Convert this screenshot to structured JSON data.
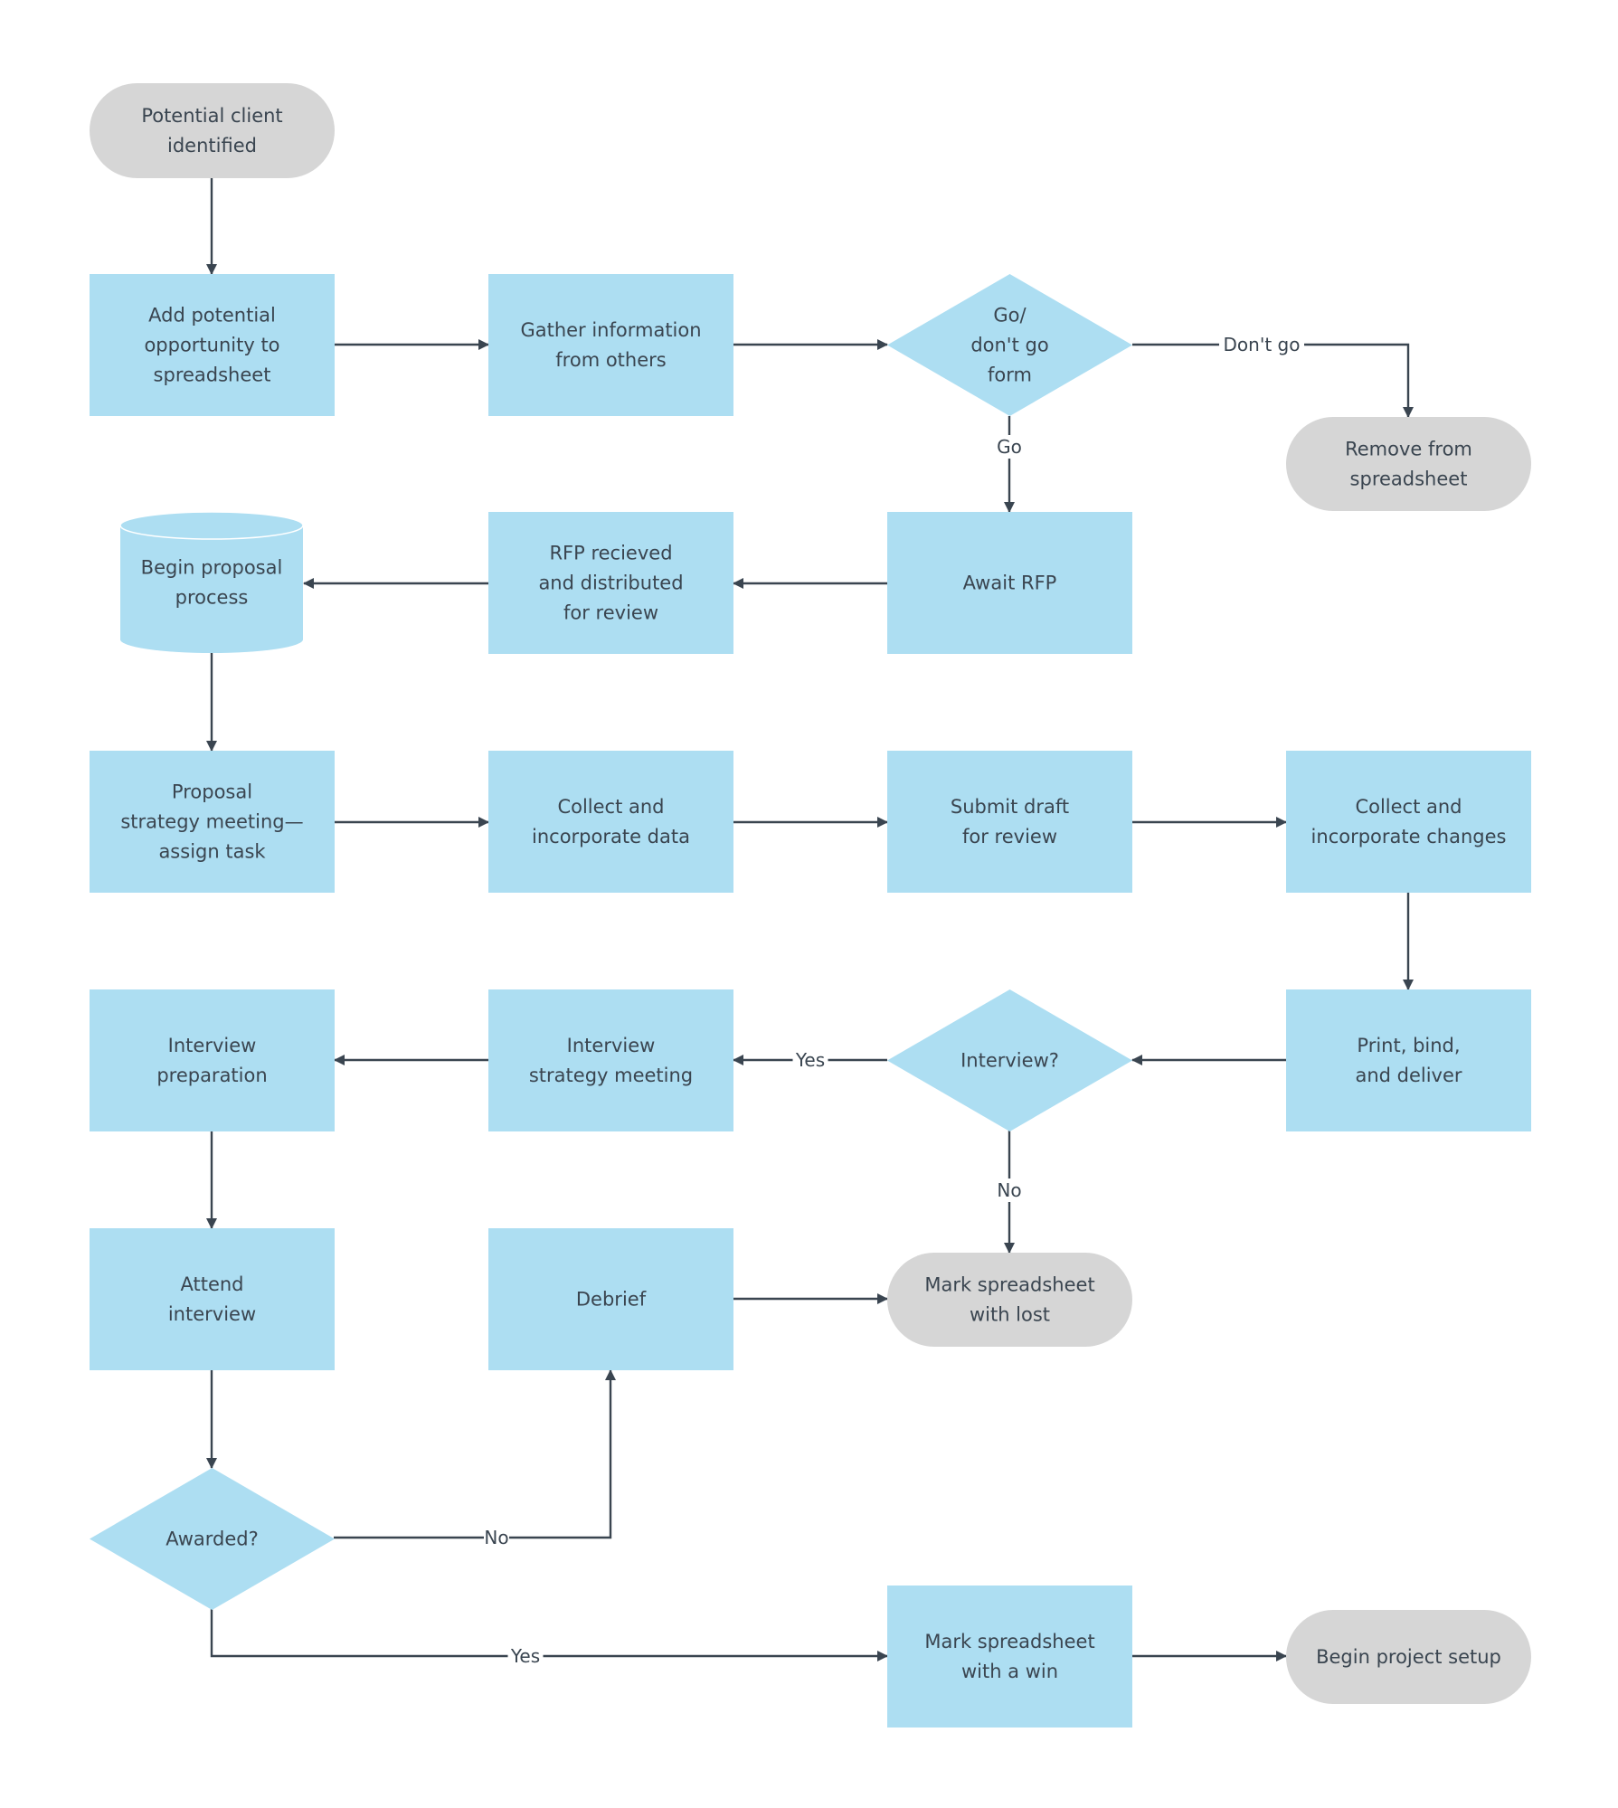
{
  "diagram": {
    "colors": {
      "process": "#addef2",
      "terminal": "#d6d6d6",
      "decision": "#addef2",
      "text": "#3a4550",
      "connector": "#3a4550"
    },
    "nodes": [
      {
        "id": "start",
        "type": "terminal",
        "lines": [
          "Potential client",
          "identified"
        ]
      },
      {
        "id": "add",
        "type": "process",
        "lines": [
          "Add potential",
          "opportunity to",
          "spreadsheet"
        ]
      },
      {
        "id": "gather",
        "type": "process",
        "lines": [
          "Gather information",
          "from others"
        ]
      },
      {
        "id": "gonogo",
        "type": "decision",
        "lines": [
          "Go/",
          "don't go",
          "form"
        ]
      },
      {
        "id": "remove",
        "type": "terminal",
        "lines": [
          "Remove from",
          "spreadsheet"
        ]
      },
      {
        "id": "await",
        "type": "process",
        "lines": [
          "Await RFP"
        ]
      },
      {
        "id": "rfp",
        "type": "process",
        "lines": [
          "RFP recieved",
          "and distributed",
          "for review"
        ]
      },
      {
        "id": "begin",
        "type": "database",
        "lines": [
          "Begin proposal",
          "process"
        ]
      },
      {
        "id": "strategy",
        "type": "process",
        "lines": [
          "Proposal",
          "strategy meeting—",
          "assign task"
        ]
      },
      {
        "id": "collectdata",
        "type": "process",
        "lines": [
          "Collect and",
          "incorporate data"
        ]
      },
      {
        "id": "submit",
        "type": "process",
        "lines": [
          "Submit draft",
          "for review"
        ]
      },
      {
        "id": "collectchanges",
        "type": "process",
        "lines": [
          "Collect and",
          "incorporate changes"
        ]
      },
      {
        "id": "print",
        "type": "process",
        "lines": [
          "Print, bind,",
          "and deliver"
        ]
      },
      {
        "id": "interviewq",
        "type": "decision",
        "lines": [
          "Interview?"
        ]
      },
      {
        "id": "intstrategy",
        "type": "process",
        "lines": [
          "Interview",
          "strategy meeting"
        ]
      },
      {
        "id": "intprep",
        "type": "process",
        "lines": [
          "Interview",
          "preparation"
        ]
      },
      {
        "id": "attend",
        "type": "process",
        "lines": [
          "Attend",
          "interview"
        ]
      },
      {
        "id": "debrief",
        "type": "process",
        "lines": [
          "Debrief"
        ]
      },
      {
        "id": "lost",
        "type": "terminal",
        "lines": [
          "Mark spreadsheet",
          "with lost"
        ]
      },
      {
        "id": "awarded",
        "type": "decision",
        "lines": [
          "Awarded?"
        ]
      },
      {
        "id": "win",
        "type": "process",
        "lines": [
          "Mark spreadsheet",
          "with a win"
        ]
      },
      {
        "id": "setup",
        "type": "terminal",
        "lines": [
          "Begin project setup"
        ]
      }
    ],
    "edges": [
      {
        "from": "start",
        "to": "add",
        "label": ""
      },
      {
        "from": "add",
        "to": "gather",
        "label": ""
      },
      {
        "from": "gather",
        "to": "gonogo",
        "label": ""
      },
      {
        "from": "gonogo",
        "to": "remove",
        "label": "Don't go"
      },
      {
        "from": "gonogo",
        "to": "await",
        "label": "Go"
      },
      {
        "from": "await",
        "to": "rfp",
        "label": ""
      },
      {
        "from": "rfp",
        "to": "begin",
        "label": ""
      },
      {
        "from": "begin",
        "to": "strategy",
        "label": ""
      },
      {
        "from": "strategy",
        "to": "collectdata",
        "label": ""
      },
      {
        "from": "collectdata",
        "to": "submit",
        "label": ""
      },
      {
        "from": "submit",
        "to": "collectchanges",
        "label": ""
      },
      {
        "from": "collectchanges",
        "to": "print",
        "label": ""
      },
      {
        "from": "print",
        "to": "interviewq",
        "label": ""
      },
      {
        "from": "interviewq",
        "to": "intstrategy",
        "label": "Yes"
      },
      {
        "from": "interviewq",
        "to": "lost",
        "label": "No"
      },
      {
        "from": "intstrategy",
        "to": "intprep",
        "label": ""
      },
      {
        "from": "intprep",
        "to": "attend",
        "label": ""
      },
      {
        "from": "attend",
        "to": "awarded",
        "label": ""
      },
      {
        "from": "awarded",
        "to": "debrief",
        "label": "No"
      },
      {
        "from": "awarded",
        "to": "win",
        "label": "Yes"
      },
      {
        "from": "debrief",
        "to": "lost",
        "label": ""
      },
      {
        "from": "win",
        "to": "setup",
        "label": ""
      }
    ]
  }
}
